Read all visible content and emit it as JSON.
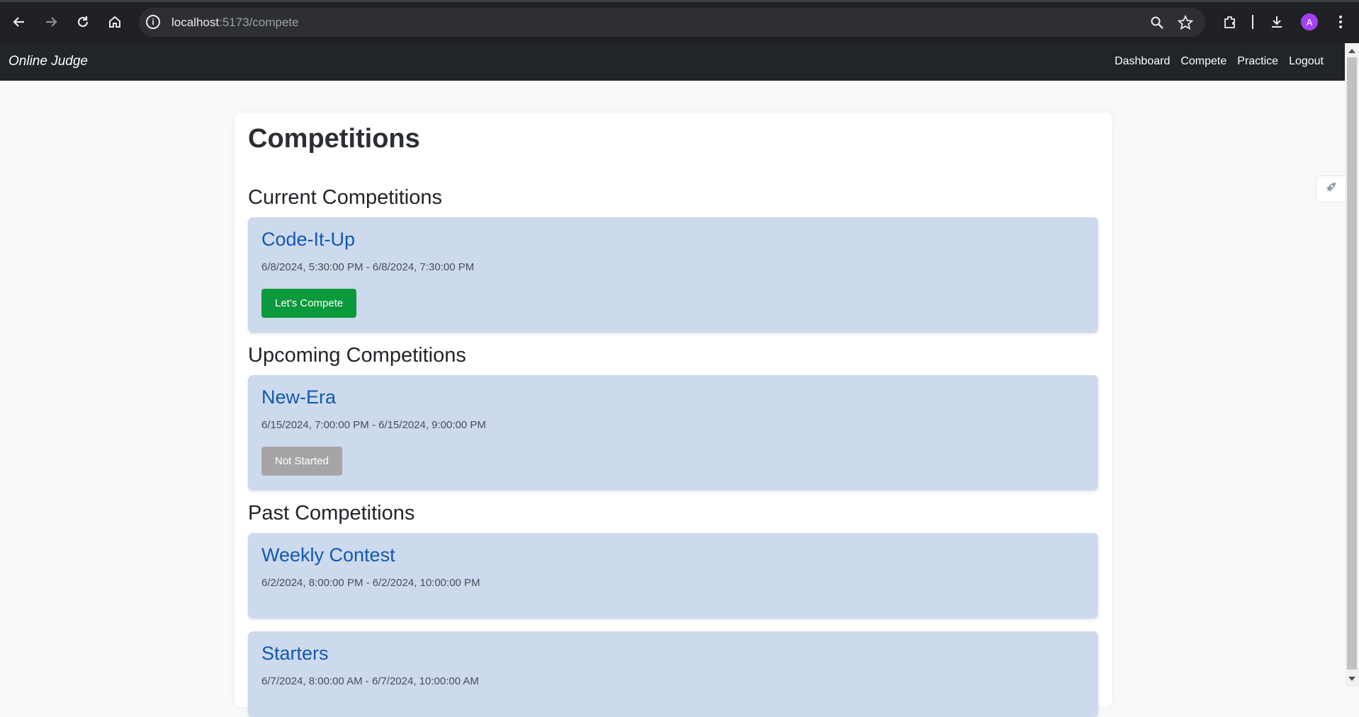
{
  "browser": {
    "url_host": "localhost",
    "url_path": ":5173/compete",
    "profile_initial": "A"
  },
  "navbar": {
    "brand": "Online Judge",
    "links": [
      "Dashboard",
      "Compete",
      "Practice",
      "Logout"
    ]
  },
  "page": {
    "title": "Competitions",
    "sections": {
      "current": {
        "title": "Current Competitions",
        "items": [
          {
            "name": "Code-It-Up",
            "dates": "6/8/2024, 5:30:00 PM - 6/8/2024, 7:30:00 PM",
            "button": "Let's Compete"
          }
        ]
      },
      "upcoming": {
        "title": "Upcoming Competitions",
        "items": [
          {
            "name": "New-Era",
            "dates": "6/15/2024, 7:00:00 PM - 6/15/2024, 9:00:00 PM",
            "button": "Not Started"
          }
        ]
      },
      "past": {
        "title": "Past Competitions",
        "items": [
          {
            "name": "Weekly Contest",
            "dates": "6/2/2024, 8:00:00 PM - 6/2/2024, 10:00:00 PM"
          },
          {
            "name": "Starters",
            "dates": "6/7/2024, 8:00:00 AM - 6/7/2024, 10:00:00 AM"
          }
        ]
      }
    }
  },
  "colors": {
    "navbar_bg": "#212529",
    "card_bg": "#cdd9ed",
    "link_blue": "#1258b0",
    "compete_green": "#0b9a3b",
    "disabled_gray": "#a7a4a4"
  }
}
